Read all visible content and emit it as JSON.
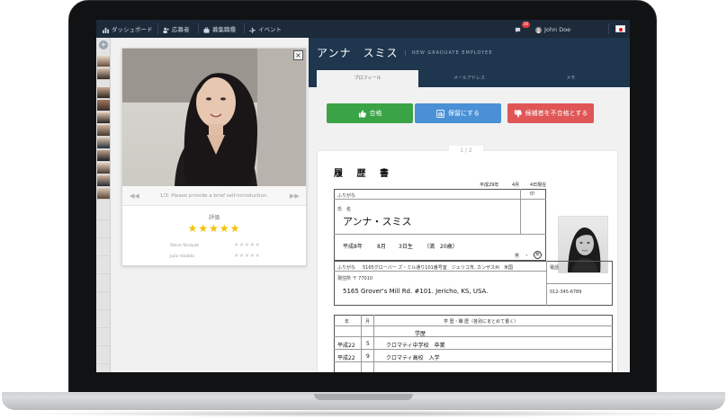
{
  "nav": {
    "dashboard": "ダッシュボード",
    "applicants": "応募者",
    "jobs": "募集職種",
    "events": "イベント",
    "notification_count": "30",
    "user_name": "John Doe"
  },
  "video": {
    "caption": "1/3: Please provide a brief self-introduction.",
    "close": "×",
    "prev": "◀◀",
    "next": "▶▶"
  },
  "rating": {
    "title": "評価",
    "overall_stars": "★★★★★",
    "overall_value": 5,
    "raters": [
      {
        "name": "Steve Skrzyak",
        "stars": "★★★★★"
      },
      {
        "name": "Julia Hadida",
        "stars": "★★★★★"
      }
    ]
  },
  "candidate": {
    "name": "アンナ　スミス",
    "role": "NEW GRADUATE EMPLOYEE"
  },
  "tabs": [
    "プロフィール",
    "メールアドレス",
    "メモ"
  ],
  "actions": {
    "pass": "合格",
    "hold": "保留にする",
    "reject": "候補者を不合格とする"
  },
  "resume": {
    "page": "1 / 2",
    "title": "履 歴 書",
    "date_era": "平成29年",
    "date_month": "4月",
    "date_day": "4日現在",
    "seal": "印",
    "furigana_label": "ふりがな",
    "name_label": "氏　名",
    "name": "アンナ・スミス",
    "birth_era": "平成8年",
    "birth_month": "8月",
    "birth_day": "3日生",
    "age": "（満　20歳）",
    "sex_male": "男",
    "sex_dot": "・",
    "sex_female": "女",
    "addr_furigana_label": "ふりがな",
    "addr_furigana": "5165グローバー ズ・ミル通り101番号室　ジェリコ市, カンザス州　米国",
    "address_label": "現住所 〒 77010",
    "address": "5165 Grover's Mill Rd. #101. Jericho, KS, USA.",
    "phone_label": "電話",
    "phone": "012-345-6789",
    "history_col_year": "年",
    "history_col_month": "月",
    "history_col_item": "学 歴・職 歴（各別にまとめて書く）",
    "history_heading": "学歴",
    "history": [
      {
        "year": "平成22",
        "month": "5",
        "item": "クロマティ中学校　卒業"
      },
      {
        "year": "平成22",
        "month": "9",
        "item": "クロマティ高校　入学"
      }
    ]
  },
  "colors": {
    "nav_bg": "#1c2a3a",
    "header_bg": "#1e364e",
    "pass": "#3aa346",
    "hold": "#4a90d6",
    "reject": "#e05656",
    "star": "#f2c200"
  }
}
